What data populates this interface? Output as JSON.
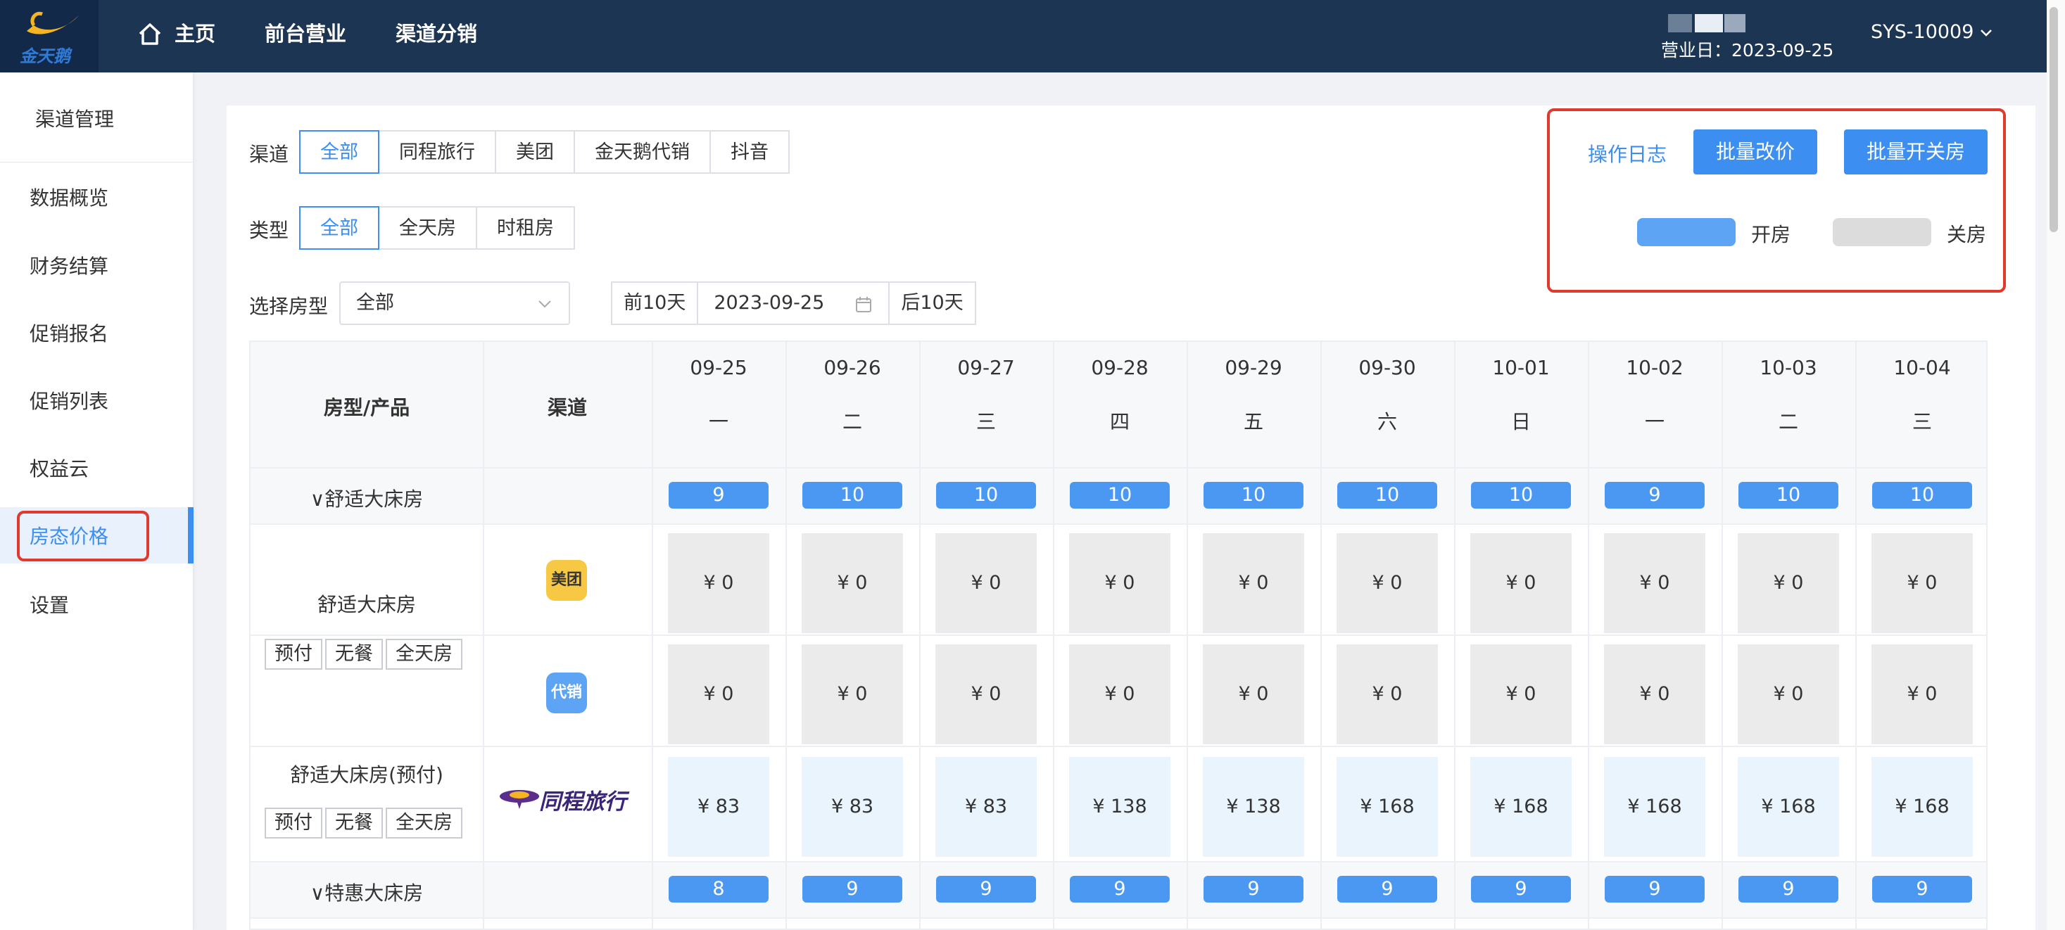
{
  "topbar": {
    "logo_text": "金天鹅",
    "nav": [
      "主页",
      "前台营业",
      "渠道分销"
    ],
    "business_date": "营业日：2023-09-25",
    "user_id": "SYS-10009"
  },
  "sidebar": {
    "title": "渠道管理",
    "items": [
      "数据概览",
      "财务结算",
      "促销报名",
      "促销列表",
      "权益云",
      "房态价格",
      "设置"
    ],
    "active": "房态价格"
  },
  "filters": {
    "channel_label": "渠道",
    "channels": [
      "全部",
      "同程旅行",
      "美团",
      "金天鹅代销",
      "抖音"
    ],
    "type_label": "类型",
    "types": [
      "全部",
      "全天房",
      "时租房"
    ],
    "roomtype_label": "选择房型",
    "roomtype_value": "全部",
    "prev_label": "前10天",
    "date_value": "2023-09-25",
    "next_label": "后10天"
  },
  "actions": {
    "log_link": "操作日志",
    "batch_price": "批量改价",
    "batch_open_close": "批量开关房",
    "legend_open": "开房",
    "legend_closed": "关房",
    "open_color": "#5da4f4",
    "closed_color": "#dcdcdc"
  },
  "table": {
    "head_roomtype": "房型/产品",
    "head_channel": "渠道",
    "dates": [
      "09-25",
      "09-26",
      "09-27",
      "09-28",
      "09-29",
      "09-30",
      "10-01",
      "10-02",
      "10-03",
      "10-04"
    ],
    "weekdays": [
      "一",
      "二",
      "三",
      "四",
      "五",
      "六",
      "日",
      "一",
      "二",
      "三"
    ],
    "groups": [
      {
        "name": "∨舒适大床房",
        "availability": [
          "9",
          "10",
          "10",
          "10",
          "10",
          "10",
          "10",
          "9",
          "10",
          "10"
        ]
      },
      {
        "name": "∨特惠大床房",
        "availability": [
          "8",
          "9",
          "9",
          "9",
          "9",
          "9",
          "9",
          "9",
          "9",
          "9"
        ]
      }
    ],
    "products": [
      {
        "name": "舒适大床房",
        "tags": [
          "预付",
          "无餐",
          "全天房"
        ],
        "channels": [
          {
            "icon": "meituan-icon",
            "label": "美团",
            "prices": [
              "¥ 0",
              "¥ 0",
              "¥ 0",
              "¥ 0",
              "¥ 0",
              "¥ 0",
              "¥ 0",
              "¥ 0",
              "¥ 0",
              "¥ 0"
            ]
          },
          {
            "icon": "daixiao-icon",
            "label": "代销",
            "prices": [
              "¥ 0",
              "¥ 0",
              "¥ 0",
              "¥ 0",
              "¥ 0",
              "¥ 0",
              "¥ 0",
              "¥ 0",
              "¥ 0",
              "¥ 0"
            ]
          }
        ]
      },
      {
        "name": "舒适大床房(预付)",
        "tags": [
          "预付",
          "无餐",
          "全天房"
        ],
        "channels": [
          {
            "icon": "tongcheng-logo",
            "label": "同程旅行",
            "prices": [
              "¥ 83",
              "¥ 83",
              "¥ 83",
              "¥ 138",
              "¥ 138",
              "¥ 168",
              "¥ 168",
              "¥ 168",
              "¥ 168",
              "¥ 168"
            ]
          }
        ]
      }
    ]
  }
}
